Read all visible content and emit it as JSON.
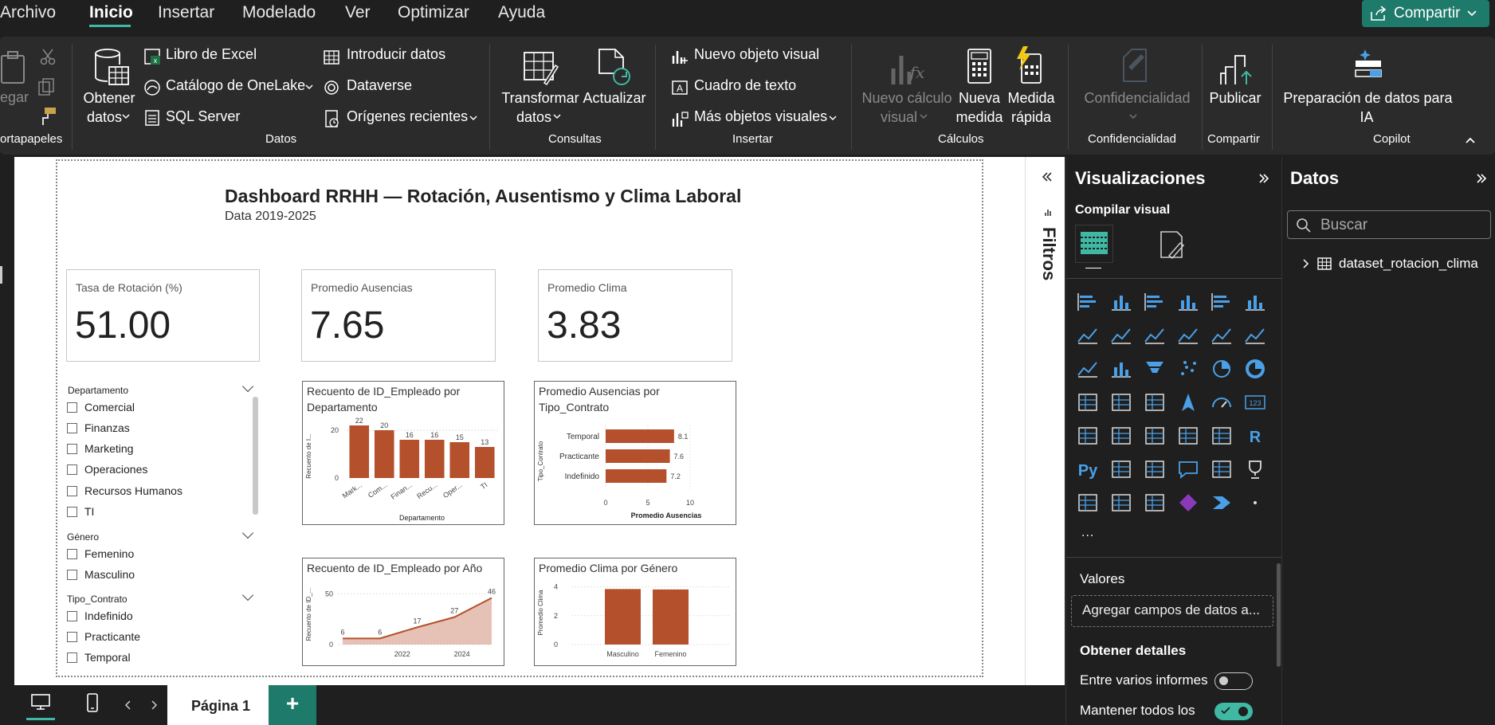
{
  "menubar": {
    "items": [
      "Archivo",
      "Inicio",
      "Insertar",
      "Modelado",
      "Ver",
      "Optimizar",
      "Ayuda"
    ],
    "share_label": "Compartir"
  },
  "ribbon": {
    "clipboard": {
      "paste": "egar",
      "group": "ortapapeles"
    },
    "datos": {
      "get_data_l1": "Obtener",
      "get_data_l2": "datos",
      "excel": "Libro de Excel",
      "onelake": "Catálogo de OneLake",
      "sql": "SQL Server",
      "enter_data": "Introducir datos",
      "dataverse": "Dataverse",
      "recent": "Orígenes recientes",
      "group": "Datos"
    },
    "consultas": {
      "transform_l1": "Transformar",
      "transform_l2": "datos",
      "refresh": "Actualizar",
      "group": "Consultas"
    },
    "insertar": {
      "new_visual": "Nuevo objeto visual",
      "textbox": "Cuadro de texto",
      "more_visuals": "Más objetos visuales",
      "group": "Insertar"
    },
    "calculos": {
      "new_calc_l1": "Nuevo cálculo",
      "new_calc_l2": "visual",
      "new_measure_l1": "Nueva",
      "new_measure_l2": "medida",
      "quick_measure_l1": "Medida",
      "quick_measure_l2": "rápida",
      "group": "Cálculos"
    },
    "confidencialidad": {
      "label": "Confidencialidad",
      "group": "Confidencialidad"
    },
    "compartir": {
      "publish": "Publicar",
      "group": "Compartir"
    },
    "copilot": {
      "prep_l1": "Preparación de datos para",
      "prep_l2": "IA",
      "group": "Copilot"
    }
  },
  "report": {
    "title": "Dashboard RRHH — Rotación, Ausentismo y Clima Laboral",
    "subtitle": "Data 2019-2025",
    "cards": [
      {
        "label": "Tasa de Rotación (%)",
        "value": "51.00"
      },
      {
        "label": "Promedio Ausencias",
        "value": "7.65"
      },
      {
        "label": "Promedio Clima",
        "value": "3.83"
      }
    ],
    "slicers": [
      {
        "title": "Departamento",
        "items": [
          "Comercial",
          "Finanzas",
          "Marketing",
          "Operaciones",
          "Recursos Humanos",
          "TI"
        ]
      },
      {
        "title": "Género",
        "items": [
          "Femenino",
          "Masculino"
        ]
      },
      {
        "title": "Tipo_Contrato",
        "items": [
          "Indefinido",
          "Practicante",
          "Temporal"
        ]
      }
    ]
  },
  "chart_data": [
    {
      "type": "bar",
      "title": "Recuento de ID_Empleado por Departamento",
      "xlabel": "Departamento",
      "ylabel": "Recuento de I...",
      "categories": [
        "Mark...",
        "Com...",
        "Finan...",
        "Recu...",
        "Oper...",
        "TI"
      ],
      "values": [
        22,
        20,
        16,
        16,
        15,
        13
      ],
      "yticks": [
        "0",
        "20"
      ],
      "ylim": [
        0,
        25
      ],
      "color": "#b4502b"
    },
    {
      "type": "bar",
      "orientation": "horizontal",
      "title": "Promedio Ausencias por Tipo_Contrato",
      "xlabel": "Promedio Ausencias",
      "ylabel": "Tipo_Contrato",
      "categories": [
        "Temporal",
        "Practicante",
        "Indefinido"
      ],
      "values": [
        8.1,
        7.6,
        7.2
      ],
      "value_labels": [
        "8.1",
        "7.6",
        "7.2"
      ],
      "xticks": [
        "0",
        "5",
        "10"
      ],
      "xlim": [
        0,
        10
      ],
      "color": "#b4502b"
    },
    {
      "type": "area",
      "title": "Recuento de ID_Empleado por Año",
      "ylabel": "Recuento de ID_...",
      "x": [
        2020,
        2021,
        2022,
        2023,
        2024,
        2025
      ],
      "values": [
        6,
        6,
        17,
        27,
        46
      ],
      "x_points": [
        2020,
        2021,
        2022,
        2023,
        2024,
        2025
      ],
      "points": [
        6,
        6,
        17,
        27,
        46
      ],
      "xticks": [
        "2022",
        "2024"
      ],
      "yticks": [
        "0",
        "50"
      ],
      "ylim": [
        0,
        55
      ],
      "color": "#b4502b"
    },
    {
      "type": "bar",
      "title": "Promedio Clima por Género",
      "ylabel": "Promedio Clima",
      "categories": [
        "Masculino",
        "Femenino"
      ],
      "values": [
        3.85,
        3.82
      ],
      "yticks": [
        "0",
        "2",
        "4"
      ],
      "ylim": [
        0,
        4.2
      ],
      "color": "#b4502b"
    }
  ],
  "filters": {
    "label": "Filtros"
  },
  "viz_pane": {
    "title": "Visualizaciones",
    "build_label": "Compilar visual",
    "more": "...",
    "values_label": "Valores",
    "add_fields": "Agregar campos de datos a...",
    "details_title": "Obtener detalles",
    "cross_report": "Entre varios informes",
    "keep_all": "Mantener todos los",
    "cross_report_on": false,
    "keep_all_on": true
  },
  "data_pane": {
    "title": "Datos",
    "search_placeholder": "Buscar",
    "dataset": "dataset_rotacion_clima"
  },
  "bottombar": {
    "page_tab": "Página 1",
    "add_page": "+"
  }
}
